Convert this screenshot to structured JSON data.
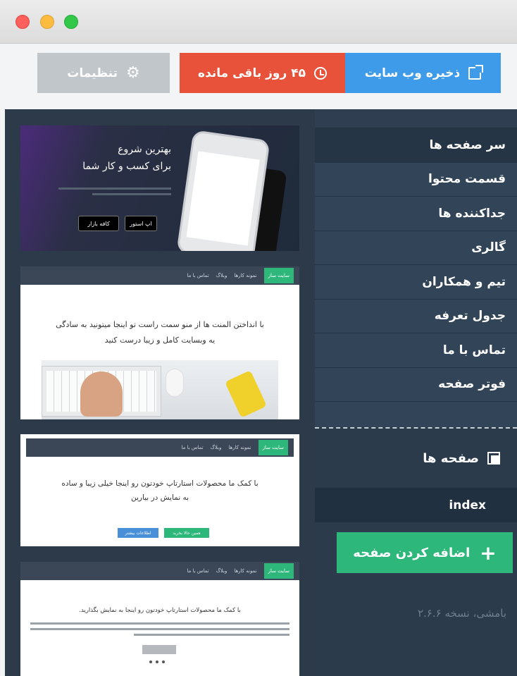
{
  "toolbar": {
    "save_label": "ذخیره وب سایت",
    "days_label": "۴۵ روز باقی مانده",
    "settings_label": "تنظیمات"
  },
  "sidebar": {
    "items": [
      {
        "label": "سر صفحه ها",
        "active": true
      },
      {
        "label": "قسمت محتوا"
      },
      {
        "label": "جداکننده ها"
      },
      {
        "label": "گالری"
      },
      {
        "label": "تیم و همکاران"
      },
      {
        "label": "جدول تعرفه"
      },
      {
        "label": "تماس با ما"
      },
      {
        "label": "فوتر صفحه"
      }
    ],
    "pages_label": "صفحه ها",
    "current_page": "index",
    "add_page_label": "اضافه کردن صفحه",
    "version": "بامشی، نسخه ۲.۶.۶"
  },
  "previews": {
    "hero": {
      "title_line1": "بهترین شروع",
      "title_line2": "برای کسب و کار شما",
      "store_apple": "اپ استور",
      "store_bazaar": "کافه بازار"
    },
    "content1": {
      "nav": [
        "سایت ساز",
        "نمونه کارها",
        "وبلاگ",
        "تماس با ما"
      ],
      "text_line1": "با انداختن المنت ها از منو سمت راست تو اینجا میتونید به سادگی",
      "text_line2": "یه وبسایت کامل و زیبا درست کنید"
    },
    "content2": {
      "nav": [
        "سایت ساز",
        "نمونه کارها",
        "وبلاگ",
        "تماس با ما"
      ],
      "text_line1": "با کمک ما محصولات استارتاپ خودتون رو اینجا خیلی زیبا و ساده",
      "text_line2": "به نمایش در بیارین",
      "btn_info": "اطلاعات بیشتر",
      "btn_buy": "همین حالا بخرید"
    },
    "content3": {
      "nav": [
        "سایت ساز",
        "نمونه کارها",
        "وبلاگ",
        "تماس با ما"
      ],
      "text": "با کمک ما محصولات استارتاپ خودتون رو اینجا به نمایش بگذارید."
    }
  }
}
